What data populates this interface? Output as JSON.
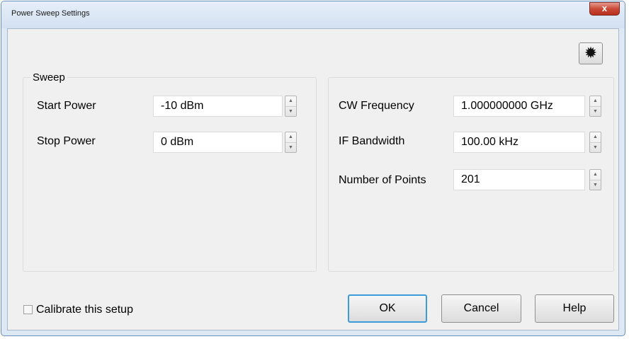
{
  "window": {
    "title": "Power Sweep Settings",
    "close_glyph": "x"
  },
  "toolbar": {
    "light_icon": "light-icon",
    "light_glyph": "✹"
  },
  "sweep": {
    "group_label": "Sweep",
    "start_power": {
      "label": "Start Power",
      "value": "-10 dBm"
    },
    "stop_power": {
      "label": "Stop Power",
      "value": "0 dBm"
    }
  },
  "settings": {
    "cw_frequency": {
      "label": "CW Frequency",
      "value": "1.000000000 GHz"
    },
    "if_bandwidth": {
      "label": "IF Bandwidth",
      "value": "100.00 kHz"
    },
    "num_points": {
      "label": "Number of Points",
      "value": "201"
    }
  },
  "calibrate": {
    "label": "Calibrate this setup",
    "checked": false
  },
  "buttons": {
    "ok": "OK",
    "cancel": "Cancel",
    "help": "Help"
  },
  "spin_glyphs": {
    "up": "▲",
    "down": "▼"
  }
}
